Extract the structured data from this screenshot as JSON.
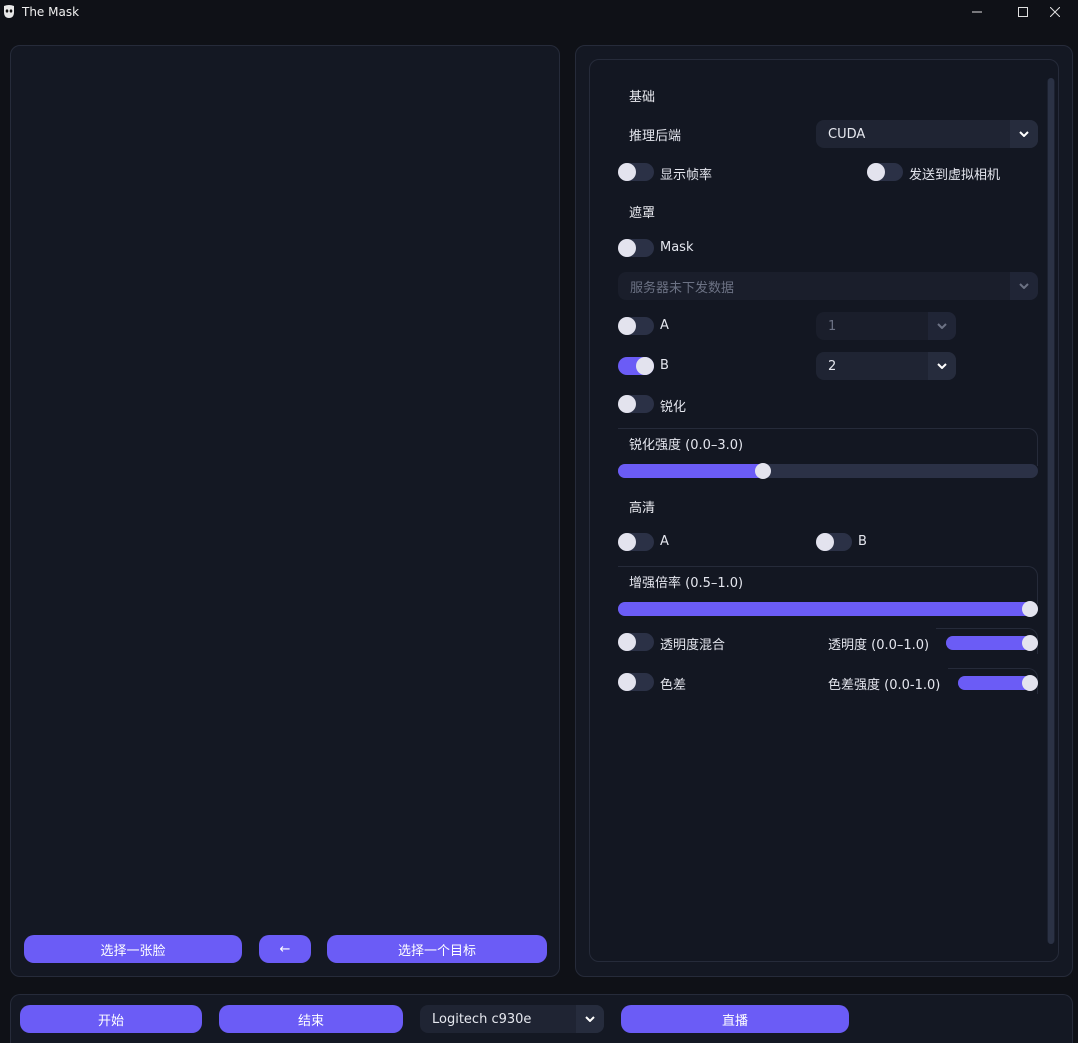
{
  "window": {
    "title": "The Mask"
  },
  "left": {
    "select_face": "选择一张脸",
    "back": "←",
    "select_target": "选择一个目标"
  },
  "settings": {
    "basic": {
      "section": "基础",
      "backend_label": "推理后端",
      "backend_value": "CUDA",
      "show_fps": "显示帧率",
      "show_fps_on": false,
      "virtual_cam": "发送到虚拟相机",
      "virtual_cam_on": false
    },
    "mask": {
      "section": "遮罩",
      "mask_label": "Mask",
      "mask_on": false,
      "server_select": "服务器未下发数据",
      "a_label": "A",
      "a_on": false,
      "a_value": "1",
      "b_label": "B",
      "b_on": true,
      "b_value": "2",
      "sharpen_label": "锐化",
      "sharpen_on": false,
      "sharpen_strength_label": "锐化强度 (0.0–3.0)",
      "sharpen_strength_fraction": 0.34
    },
    "hd": {
      "section": "高清",
      "a_label": "A",
      "a_on": false,
      "b_label": "B",
      "b_on": false,
      "enhance_label": "增强倍率 (0.5–1.0)",
      "enhance_fraction": 1.0,
      "blend_label": "透明度混合",
      "blend_on": false,
      "opacity_label": "透明度 (0.0–1.0)",
      "opacity_fraction": 1.0,
      "color_label": "色差",
      "color_on": false,
      "color_strength_label": "色差强度 (0.0-1.0)",
      "color_strength_fraction": 1.0
    }
  },
  "bottom": {
    "start": "开始",
    "stop": "结束",
    "camera": "Logitech c930e",
    "live": "直播"
  },
  "colors": {
    "accent": "#6b5cf6",
    "panel": "#141823",
    "background": "#0f1117"
  }
}
